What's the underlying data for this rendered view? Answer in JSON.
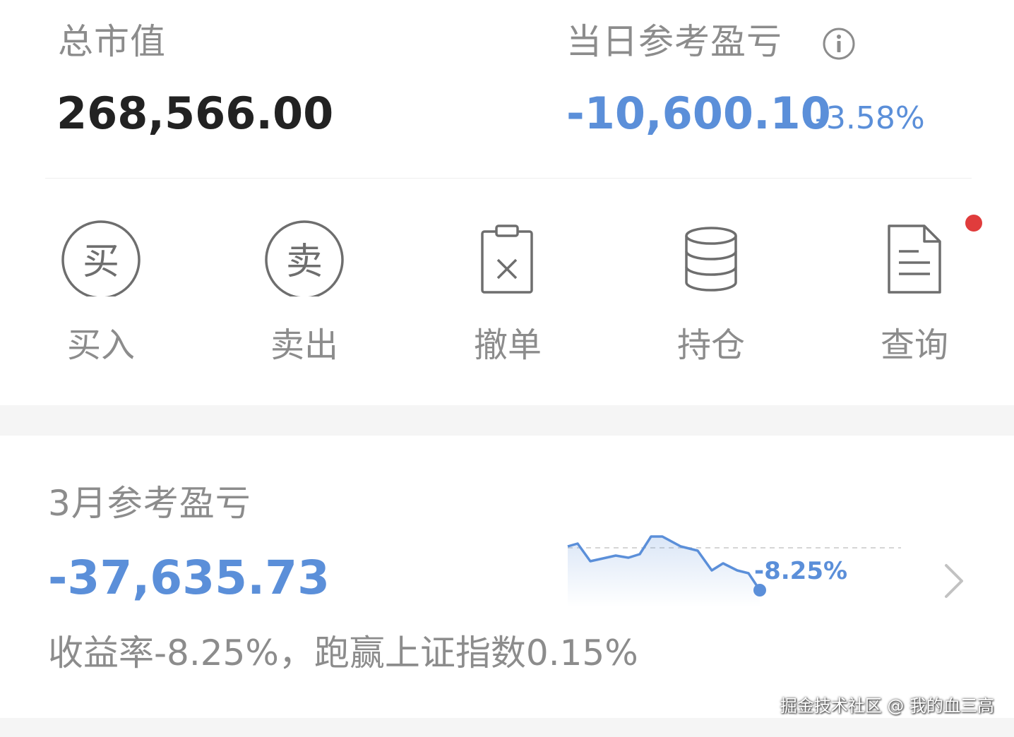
{
  "summary": {
    "market_value_label": "总市值",
    "market_value": "268,566.00",
    "daily_pnl_label": "当日参考盈亏",
    "daily_pnl": "-10,600.10",
    "daily_pnl_pct": "-3.58%"
  },
  "actions": [
    {
      "label": "买入",
      "icon": "buy-circle-icon",
      "glyph": "买"
    },
    {
      "label": "卖出",
      "icon": "sell-circle-icon",
      "glyph": "卖"
    },
    {
      "label": "撤单",
      "icon": "cancel-order-icon"
    },
    {
      "label": "持仓",
      "icon": "database-icon"
    },
    {
      "label": "查询",
      "icon": "document-icon"
    }
  ],
  "monthly": {
    "label": "3月参考盈亏",
    "value": "-37,635.73",
    "description": "收益率-8.25%，跑赢上证指数0.15%",
    "chart_end_label": "-8.25%"
  },
  "watermark": "掘金技术社区 @ 我的血三高",
  "colors": {
    "loss_blue": "#5b8fd9",
    "label_gray": "#8c8c8c",
    "notify_red": "#e03c3c"
  }
}
